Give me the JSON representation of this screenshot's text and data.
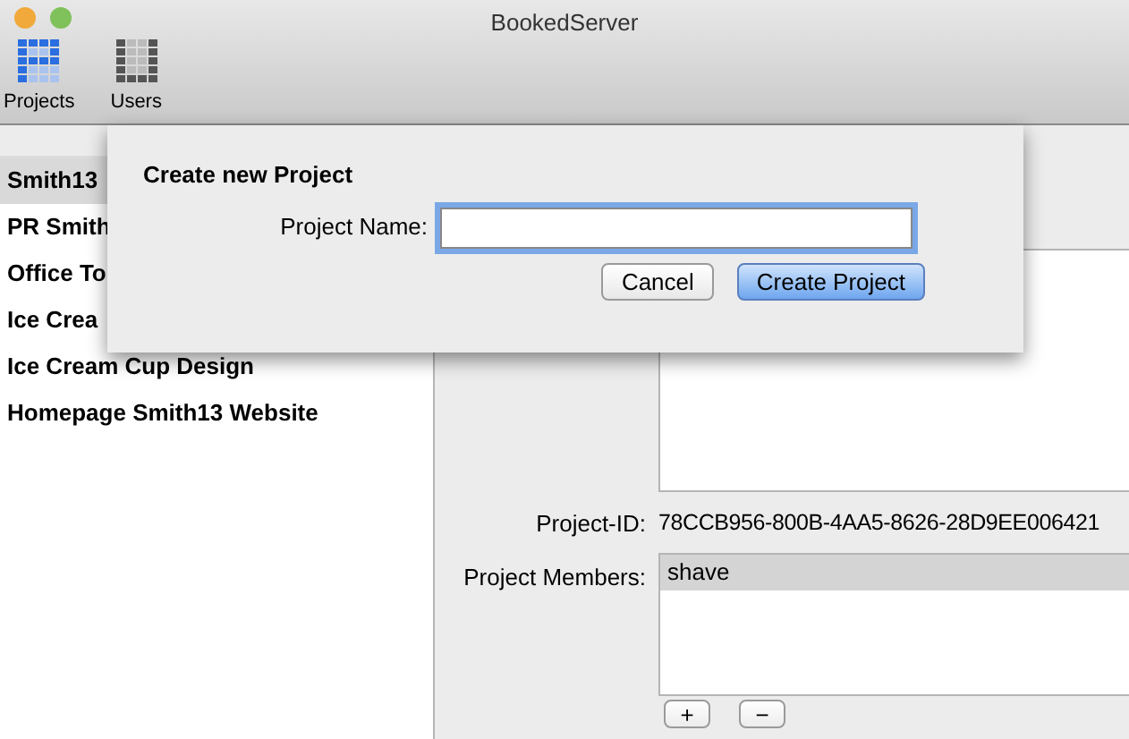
{
  "window": {
    "title": "BookedServer"
  },
  "toolbar": [
    {
      "label": "Projects",
      "selected": true
    },
    {
      "label": "Users",
      "selected": false
    }
  ],
  "sidebar": {
    "items": [
      {
        "label": "Smith13",
        "selected": true
      },
      {
        "label": "PR Smith",
        "selected": false
      },
      {
        "label": "Office To",
        "selected": false
      },
      {
        "label": "Ice Crea",
        "selected": false
      },
      {
        "label": "Ice Cream Cup Design",
        "selected": false
      },
      {
        "label": "Homepage Smith13 Website",
        "selected": false
      }
    ]
  },
  "detail": {
    "project_id_label": "Project-ID:",
    "project_id": "78CCB956-800B-4AA5-8626-28D9EE006421",
    "members_label": "Project Members:",
    "members": [
      {
        "name": "shave",
        "selected": true
      }
    ],
    "add_button": "+",
    "remove_button": "−"
  },
  "sheet": {
    "title": "Create new Project",
    "field_label": "Project Name:",
    "focused": true,
    "buttons": [
      {
        "label": "Cancel",
        "default": false
      },
      {
        "label": "Create Project",
        "default": true
      }
    ]
  }
}
